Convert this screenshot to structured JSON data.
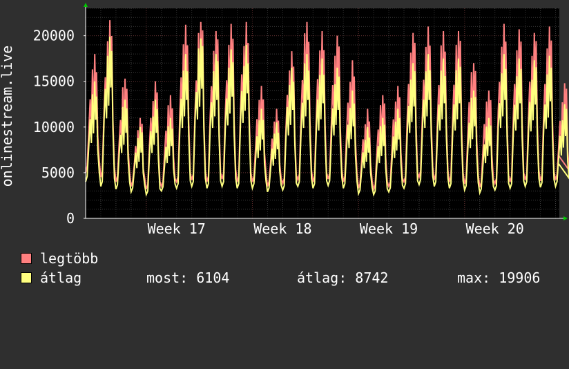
{
  "colors": {
    "background": "#2f2f2f",
    "plot_background": "#000000",
    "grid": "#5a2a2a",
    "axis": "#ffffff",
    "arrow": "#00cc00",
    "series_max": "#ff8080",
    "series_avg": "#ffff80"
  },
  "legend": {
    "max_label": "legtöbb",
    "avg_label": "átlag",
    "stats": {
      "current": "most: 6104",
      "average": "átlag: 8742",
      "maximum": "max: 19906"
    }
  },
  "chart_data": {
    "type": "line",
    "ylabel": "onlinestream.live",
    "ylim": [
      0,
      23000
    ],
    "yticks": [
      0,
      5000,
      10000,
      15000,
      20000
    ],
    "xlim": [
      0,
      31.25
    ],
    "xticks": [
      {
        "label": "Week 17",
        "x": 6
      },
      {
        "label": "Week 18",
        "x": 13
      },
      {
        "label": "Week 19",
        "x": 20
      },
      {
        "label": "Week 20",
        "x": 27
      }
    ],
    "grid": true,
    "legend_position": "bottom",
    "day_values": {
      "note_days": "one peak per day, daily peak value, days 0 to 30",
      "max_peak": [
        18000,
        21700,
        15300,
        11000,
        15000,
        13500,
        21200,
        21500,
        20500,
        21300,
        21500,
        14500,
        12000,
        18300,
        21500,
        20500,
        20000,
        17300,
        12000,
        13500,
        14500,
        20300,
        21000,
        20500,
        20500,
        17000,
        14000,
        21300,
        20700,
        20300,
        21000,
        14800
      ],
      "avg_peak": [
        15000,
        19900,
        13000,
        10000,
        13000,
        11000,
        18000,
        19700,
        18000,
        18500,
        19000,
        12000,
        10500,
        16500,
        18000,
        17500,
        16500,
        14000,
        10000,
        11000,
        12000,
        17000,
        18000,
        17500,
        17500,
        14000,
        11000,
        18000,
        17500,
        17300,
        17800,
        12500
      ],
      "max_trough": [
        5000,
        4500,
        4000,
        3500,
        3200,
        3500,
        4000,
        4200,
        4000,
        4300,
        4000,
        4000,
        3500,
        3800,
        4200,
        4000,
        4300,
        4000,
        3300,
        3200,
        3500,
        4000,
        4500,
        4200,
        4000,
        3800,
        3400,
        3800,
        4000,
        4200,
        4100,
        4200
      ],
      "avg_trough": [
        4000,
        3500,
        3200,
        2900,
        2600,
        3000,
        3300,
        3500,
        3300,
        3500,
        3300,
        3300,
        2900,
        3100,
        3500,
        3300,
        3600,
        3300,
        2700,
        2600,
        2900,
        3300,
        3700,
        3500,
        3300,
        3100,
        2800,
        3100,
        3300,
        3500,
        3400,
        3500
      ],
      "final_max": 7000,
      "final_avg": 6104
    }
  }
}
